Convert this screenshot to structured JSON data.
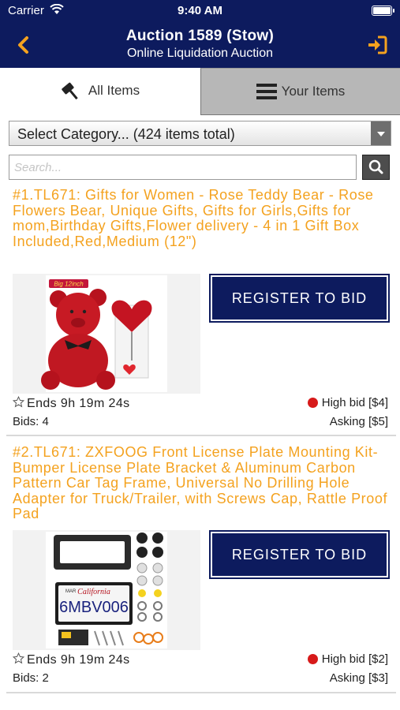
{
  "status": {
    "carrier": "Carrier",
    "time": "9:40 AM"
  },
  "header": {
    "title": "Auction 1589 (Stow)",
    "subtitle": "Online Liquidation Auction"
  },
  "tabs": [
    {
      "label": "All Items",
      "icon": "gavel-icon"
    },
    {
      "label": "Your Items",
      "icon": "list-icon"
    }
  ],
  "filters": {
    "category": "Select Category... (424 items total)",
    "search_placeholder": "Search..."
  },
  "lots": [
    {
      "title": "#1.TL671: Gifts for Women - Rose Teddy Bear - Rose Flowers Bear, Unique Gifts, Gifts for Girls,Gifts for mom,Birthday Gifts,Flower delivery - 4 in 1 Gift Box Included,Red,Medium (12\")",
      "image_label": "Big 12inch",
      "register": "REGISTER TO BID",
      "ends": "Ends 9h 19m 24s",
      "high_bid": "High bid [$4]",
      "bids": "Bids: 4",
      "asking": "Asking [$5]"
    },
    {
      "title": "#2.TL671: ZXFOOG Front License Plate Mounting Kit- Bumper License Plate Bracket & Aluminum Carbon Pattern Car Tag Frame, Universal No Drilling Hole Adapter for Truck/Trailer, with Screws Cap, Rattle Proof Pad",
      "plate_state": "California",
      "plate_number": "6MBV006",
      "plate_tag": "MAR",
      "register": "REGISTER TO BID",
      "ends": "Ends 9h 19m 24s",
      "high_bid": "High bid [$2]",
      "bids": "Bids: 2",
      "asking": "Asking [$3]"
    }
  ],
  "colors": {
    "navy": "#0d1b5e",
    "accent": "#f4a21f",
    "bid_dot": "#d71a1a"
  }
}
